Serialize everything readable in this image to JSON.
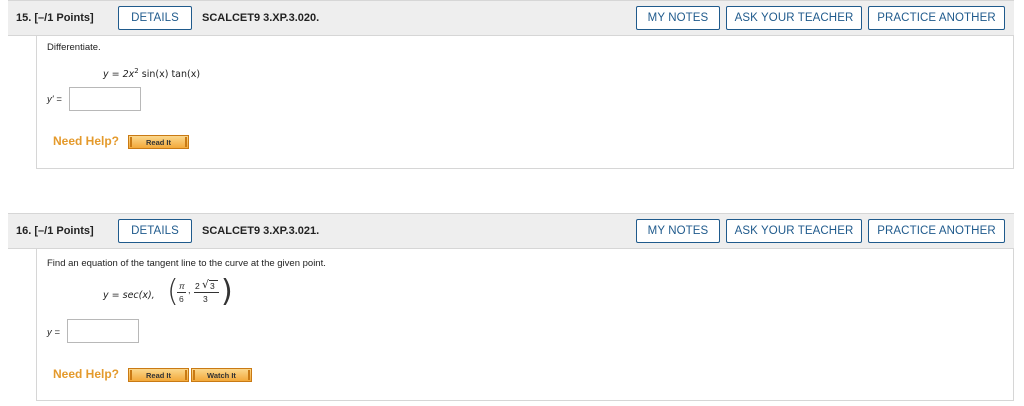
{
  "questions": [
    {
      "number": "15.",
      "points": "[–/1 Points]",
      "details_label": "DETAILS",
      "code": "SCALCET9 3.XP.3.020.",
      "my_notes_label": "MY NOTES",
      "ask_teacher_label": "ASK YOUR TEACHER",
      "practice_label": "PRACTICE ANOTHER",
      "prompt": "Differentiate.",
      "eq_lhs": "y = 2x",
      "eq_exp": "2",
      "eq_rhs": " sin(x) tan(x)",
      "answer_label": "y' =",
      "answer_value": "",
      "need_help": "Need Help?",
      "help_buttons": [
        "Read It"
      ]
    },
    {
      "number": "16.",
      "points": "[–/1 Points]",
      "details_label": "DETAILS",
      "code": "SCALCET9 3.XP.3.021.",
      "my_notes_label": "MY NOTES",
      "ask_teacher_label": "ASK YOUR TEACHER",
      "practice_label": "PRACTICE ANOTHER",
      "prompt": "Find an equation of the tangent line to the curve at the given point.",
      "eq_lhs": "y = sec(x),",
      "point_x_num": "π",
      "point_x_den": "6",
      "point_y_num": "2",
      "point_y_root": "3",
      "point_y_den": "3",
      "answer_label": "y =",
      "answer_value": "",
      "need_help": "Need Help?",
      "help_buttons": [
        "Read It",
        "Watch It"
      ]
    }
  ]
}
